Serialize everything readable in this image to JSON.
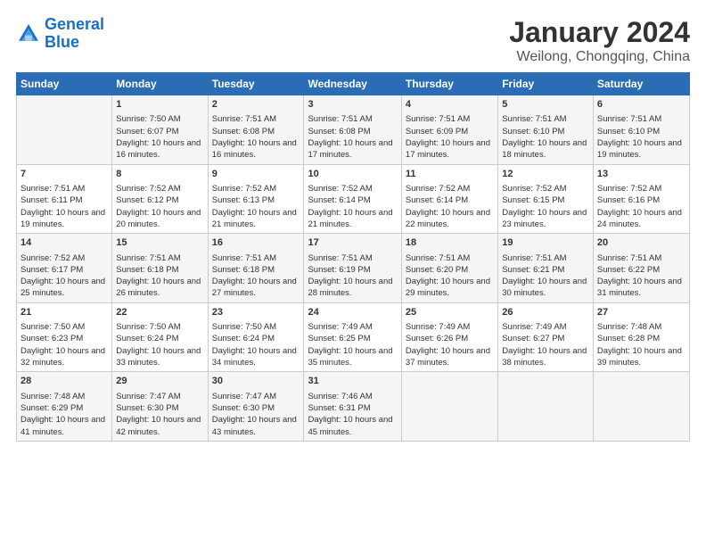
{
  "logo": {
    "line1": "General",
    "line2": "Blue"
  },
  "title": "January 2024",
  "subtitle": "Weilong, Chongqing, China",
  "headers": [
    "Sunday",
    "Monday",
    "Tuesday",
    "Wednesday",
    "Thursday",
    "Friday",
    "Saturday"
  ],
  "weeks": [
    [
      {
        "day": "",
        "sunrise": "",
        "sunset": "",
        "daylight": ""
      },
      {
        "day": "1",
        "sunrise": "Sunrise: 7:50 AM",
        "sunset": "Sunset: 6:07 PM",
        "daylight": "Daylight: 10 hours and 16 minutes."
      },
      {
        "day": "2",
        "sunrise": "Sunrise: 7:51 AM",
        "sunset": "Sunset: 6:08 PM",
        "daylight": "Daylight: 10 hours and 16 minutes."
      },
      {
        "day": "3",
        "sunrise": "Sunrise: 7:51 AM",
        "sunset": "Sunset: 6:08 PM",
        "daylight": "Daylight: 10 hours and 17 minutes."
      },
      {
        "day": "4",
        "sunrise": "Sunrise: 7:51 AM",
        "sunset": "Sunset: 6:09 PM",
        "daylight": "Daylight: 10 hours and 17 minutes."
      },
      {
        "day": "5",
        "sunrise": "Sunrise: 7:51 AM",
        "sunset": "Sunset: 6:10 PM",
        "daylight": "Daylight: 10 hours and 18 minutes."
      },
      {
        "day": "6",
        "sunrise": "Sunrise: 7:51 AM",
        "sunset": "Sunset: 6:10 PM",
        "daylight": "Daylight: 10 hours and 19 minutes."
      }
    ],
    [
      {
        "day": "7",
        "sunrise": "Sunrise: 7:51 AM",
        "sunset": "Sunset: 6:11 PM",
        "daylight": "Daylight: 10 hours and 19 minutes."
      },
      {
        "day": "8",
        "sunrise": "Sunrise: 7:52 AM",
        "sunset": "Sunset: 6:12 PM",
        "daylight": "Daylight: 10 hours and 20 minutes."
      },
      {
        "day": "9",
        "sunrise": "Sunrise: 7:52 AM",
        "sunset": "Sunset: 6:13 PM",
        "daylight": "Daylight: 10 hours and 21 minutes."
      },
      {
        "day": "10",
        "sunrise": "Sunrise: 7:52 AM",
        "sunset": "Sunset: 6:14 PM",
        "daylight": "Daylight: 10 hours and 21 minutes."
      },
      {
        "day": "11",
        "sunrise": "Sunrise: 7:52 AM",
        "sunset": "Sunset: 6:14 PM",
        "daylight": "Daylight: 10 hours and 22 minutes."
      },
      {
        "day": "12",
        "sunrise": "Sunrise: 7:52 AM",
        "sunset": "Sunset: 6:15 PM",
        "daylight": "Daylight: 10 hours and 23 minutes."
      },
      {
        "day": "13",
        "sunrise": "Sunrise: 7:52 AM",
        "sunset": "Sunset: 6:16 PM",
        "daylight": "Daylight: 10 hours and 24 minutes."
      }
    ],
    [
      {
        "day": "14",
        "sunrise": "Sunrise: 7:52 AM",
        "sunset": "Sunset: 6:17 PM",
        "daylight": "Daylight: 10 hours and 25 minutes."
      },
      {
        "day": "15",
        "sunrise": "Sunrise: 7:51 AM",
        "sunset": "Sunset: 6:18 PM",
        "daylight": "Daylight: 10 hours and 26 minutes."
      },
      {
        "day": "16",
        "sunrise": "Sunrise: 7:51 AM",
        "sunset": "Sunset: 6:18 PM",
        "daylight": "Daylight: 10 hours and 27 minutes."
      },
      {
        "day": "17",
        "sunrise": "Sunrise: 7:51 AM",
        "sunset": "Sunset: 6:19 PM",
        "daylight": "Daylight: 10 hours and 28 minutes."
      },
      {
        "day": "18",
        "sunrise": "Sunrise: 7:51 AM",
        "sunset": "Sunset: 6:20 PM",
        "daylight": "Daylight: 10 hours and 29 minutes."
      },
      {
        "day": "19",
        "sunrise": "Sunrise: 7:51 AM",
        "sunset": "Sunset: 6:21 PM",
        "daylight": "Daylight: 10 hours and 30 minutes."
      },
      {
        "day": "20",
        "sunrise": "Sunrise: 7:51 AM",
        "sunset": "Sunset: 6:22 PM",
        "daylight": "Daylight: 10 hours and 31 minutes."
      }
    ],
    [
      {
        "day": "21",
        "sunrise": "Sunrise: 7:50 AM",
        "sunset": "Sunset: 6:23 PM",
        "daylight": "Daylight: 10 hours and 32 minutes."
      },
      {
        "day": "22",
        "sunrise": "Sunrise: 7:50 AM",
        "sunset": "Sunset: 6:24 PM",
        "daylight": "Daylight: 10 hours and 33 minutes."
      },
      {
        "day": "23",
        "sunrise": "Sunrise: 7:50 AM",
        "sunset": "Sunset: 6:24 PM",
        "daylight": "Daylight: 10 hours and 34 minutes."
      },
      {
        "day": "24",
        "sunrise": "Sunrise: 7:49 AM",
        "sunset": "Sunset: 6:25 PM",
        "daylight": "Daylight: 10 hours and 35 minutes."
      },
      {
        "day": "25",
        "sunrise": "Sunrise: 7:49 AM",
        "sunset": "Sunset: 6:26 PM",
        "daylight": "Daylight: 10 hours and 37 minutes."
      },
      {
        "day": "26",
        "sunrise": "Sunrise: 7:49 AM",
        "sunset": "Sunset: 6:27 PM",
        "daylight": "Daylight: 10 hours and 38 minutes."
      },
      {
        "day": "27",
        "sunrise": "Sunrise: 7:48 AM",
        "sunset": "Sunset: 6:28 PM",
        "daylight": "Daylight: 10 hours and 39 minutes."
      }
    ],
    [
      {
        "day": "28",
        "sunrise": "Sunrise: 7:48 AM",
        "sunset": "Sunset: 6:29 PM",
        "daylight": "Daylight: 10 hours and 41 minutes."
      },
      {
        "day": "29",
        "sunrise": "Sunrise: 7:47 AM",
        "sunset": "Sunset: 6:30 PM",
        "daylight": "Daylight: 10 hours and 42 minutes."
      },
      {
        "day": "30",
        "sunrise": "Sunrise: 7:47 AM",
        "sunset": "Sunset: 6:30 PM",
        "daylight": "Daylight: 10 hours and 43 minutes."
      },
      {
        "day": "31",
        "sunrise": "Sunrise: 7:46 AM",
        "sunset": "Sunset: 6:31 PM",
        "daylight": "Daylight: 10 hours and 45 minutes."
      },
      {
        "day": "",
        "sunrise": "",
        "sunset": "",
        "daylight": ""
      },
      {
        "day": "",
        "sunrise": "",
        "sunset": "",
        "daylight": ""
      },
      {
        "day": "",
        "sunrise": "",
        "sunset": "",
        "daylight": ""
      }
    ]
  ]
}
